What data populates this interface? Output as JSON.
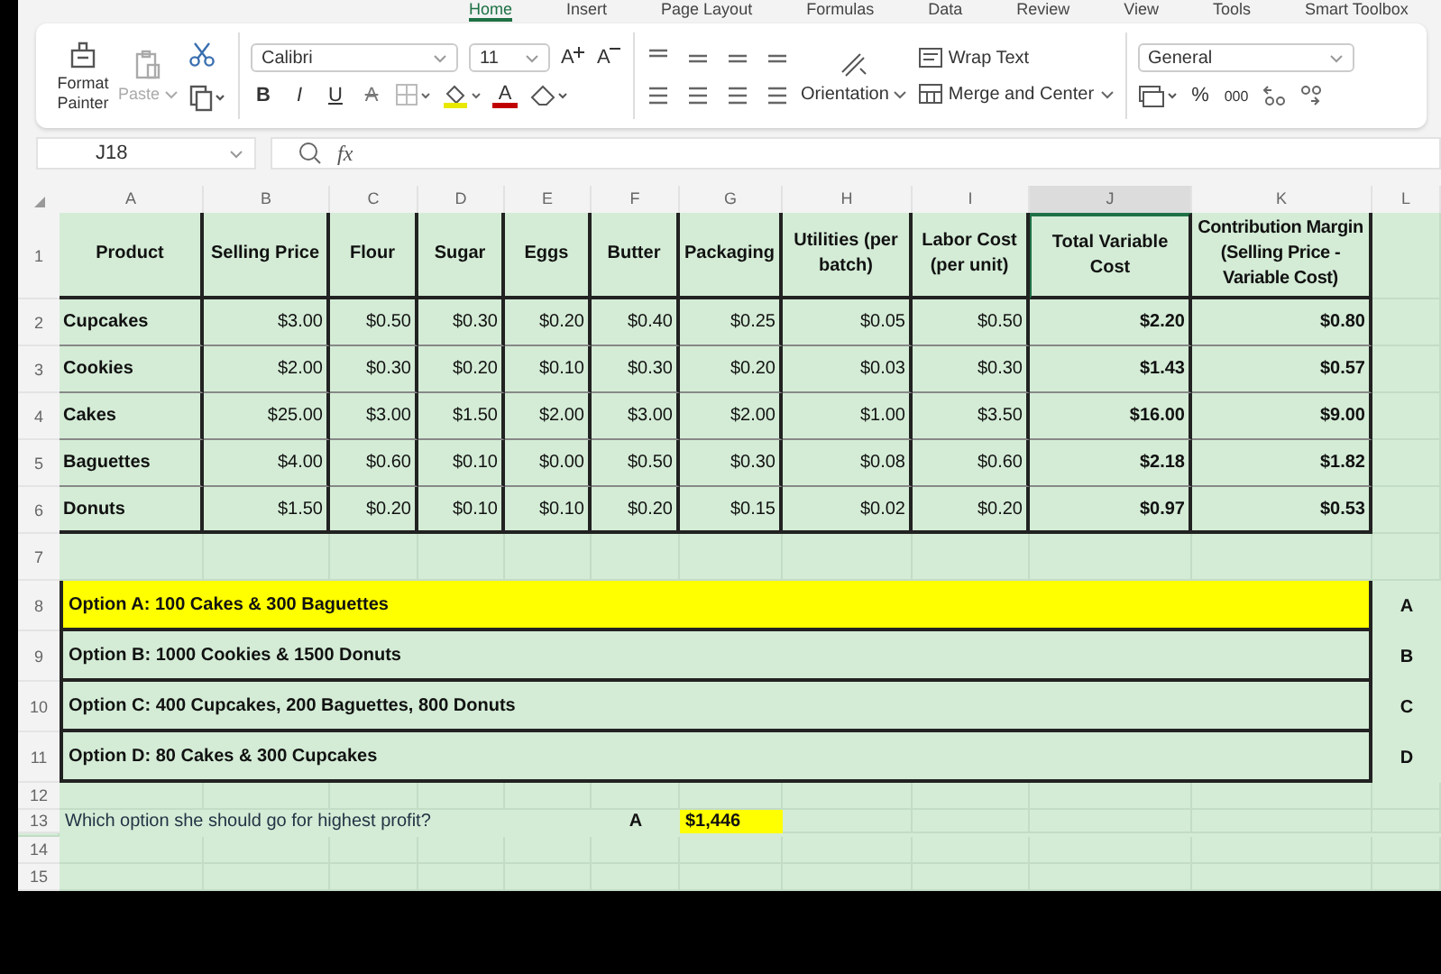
{
  "menu_tabs": [
    {
      "label": "Home",
      "selected": true
    },
    {
      "label": "Insert",
      "selected": false
    },
    {
      "label": "Page Layout",
      "selected": false
    },
    {
      "label": "Formulas",
      "selected": false
    },
    {
      "label": "Data",
      "selected": false
    },
    {
      "label": "Review",
      "selected": false
    },
    {
      "label": "View",
      "selected": false
    },
    {
      "label": "Tools",
      "selected": false
    },
    {
      "label": "Smart Toolbox",
      "selected": false
    }
  ],
  "ribbon": {
    "format_painter": "Format Painter",
    "paste": "Paste",
    "font_name": "Calibri",
    "font_size": "11",
    "bold": "B",
    "italic": "I",
    "underline": "U",
    "strikethrough": "A",
    "font_color": "A",
    "grow_font": "A",
    "shrink_font": "A",
    "orientation": "Orientation",
    "wrap_text": "Wrap Text",
    "merge": "Merge and Center",
    "number_format": "General",
    "percent": "%",
    "thousands": "000"
  },
  "formula_bar": {
    "cell_ref": "J18",
    "fx": "fx"
  },
  "sheet": {
    "columns": [
      {
        "label": "A",
        "selected": false
      },
      {
        "label": "B",
        "selected": false
      },
      {
        "label": "C",
        "selected": false
      },
      {
        "label": "D",
        "selected": false
      },
      {
        "label": "E",
        "selected": false
      },
      {
        "label": "F",
        "selected": false
      },
      {
        "label": "G",
        "selected": false
      },
      {
        "label": "H",
        "selected": false
      },
      {
        "label": "I",
        "selected": false
      },
      {
        "label": "J",
        "selected": true
      },
      {
        "label": "K",
        "selected": false
      },
      {
        "label": "L",
        "selected": false
      }
    ],
    "rows": [
      {
        "kind": "header",
        "number": "1",
        "cells": [
          "Product",
          "Selling Price",
          "Flour",
          "Sugar",
          "Eggs",
          "Butter",
          "Packaging",
          "Utilities (per batch)",
          "Labor Cost (per unit)",
          "Total Variable Cost",
          "Contribution Margin (Selling Price - Variable Cost)"
        ]
      },
      {
        "kind": "data",
        "number": "2",
        "cells": [
          "Cupcakes",
          "$3.00",
          "$0.50",
          "$0.30",
          "$0.20",
          "$0.40",
          "$0.25",
          "$0.05",
          "$0.50",
          "$2.20",
          "$0.80"
        ]
      },
      {
        "kind": "data",
        "number": "3",
        "cells": [
          "Cookies",
          "$2.00",
          "$0.30",
          "$0.20",
          "$0.10",
          "$0.30",
          "$0.20",
          "$0.03",
          "$0.30",
          "$1.43",
          "$0.57"
        ]
      },
      {
        "kind": "data",
        "number": "4",
        "cells": [
          "Cakes",
          "$25.00",
          "$3.00",
          "$1.50",
          "$2.00",
          "$3.00",
          "$2.00",
          "$1.00",
          "$3.50",
          "$16.00",
          "$9.00"
        ]
      },
      {
        "kind": "data",
        "number": "5",
        "cells": [
          "Baguettes",
          "$4.00",
          "$0.60",
          "$0.10",
          "$0.00",
          "$0.50",
          "$0.30",
          "$0.08",
          "$0.60",
          "$2.18",
          "$1.82"
        ]
      },
      {
        "kind": "data",
        "number": "6",
        "cells": [
          "Donuts",
          "$1.50",
          "$0.20",
          "$0.10",
          "$0.10",
          "$0.20",
          "$0.15",
          "$0.02",
          "$0.20",
          "$0.97",
          "$0.53"
        ]
      },
      {
        "kind": "blank",
        "number": "7"
      },
      {
        "kind": "option",
        "number": "8",
        "text": "Option A: 100 Cakes & 300 Baguettes",
        "highlighted": true,
        "answer": "A"
      },
      {
        "kind": "option",
        "number": "9",
        "text": "Option B: 1000 Cookies & 1500 Donuts",
        "highlighted": false,
        "answer": "B"
      },
      {
        "kind": "option",
        "number": "10",
        "text": "Option C: 400 Cupcakes, 200 Baguettes, 800 Donuts",
        "highlighted": false,
        "answer": "C"
      },
      {
        "kind": "option",
        "number": "11",
        "text": "Option D: 80 Cakes & 300 Cupcakes",
        "highlighted": false,
        "answer": "D"
      },
      {
        "kind": "blank",
        "number": "12"
      },
      {
        "kind": "question",
        "number": "13",
        "text": "Which option she should go for highest profit?",
        "answer": "A",
        "result": "$1,446"
      },
      {
        "kind": "blank",
        "number": "14"
      },
      {
        "kind": "blank",
        "number": "15"
      }
    ]
  }
}
